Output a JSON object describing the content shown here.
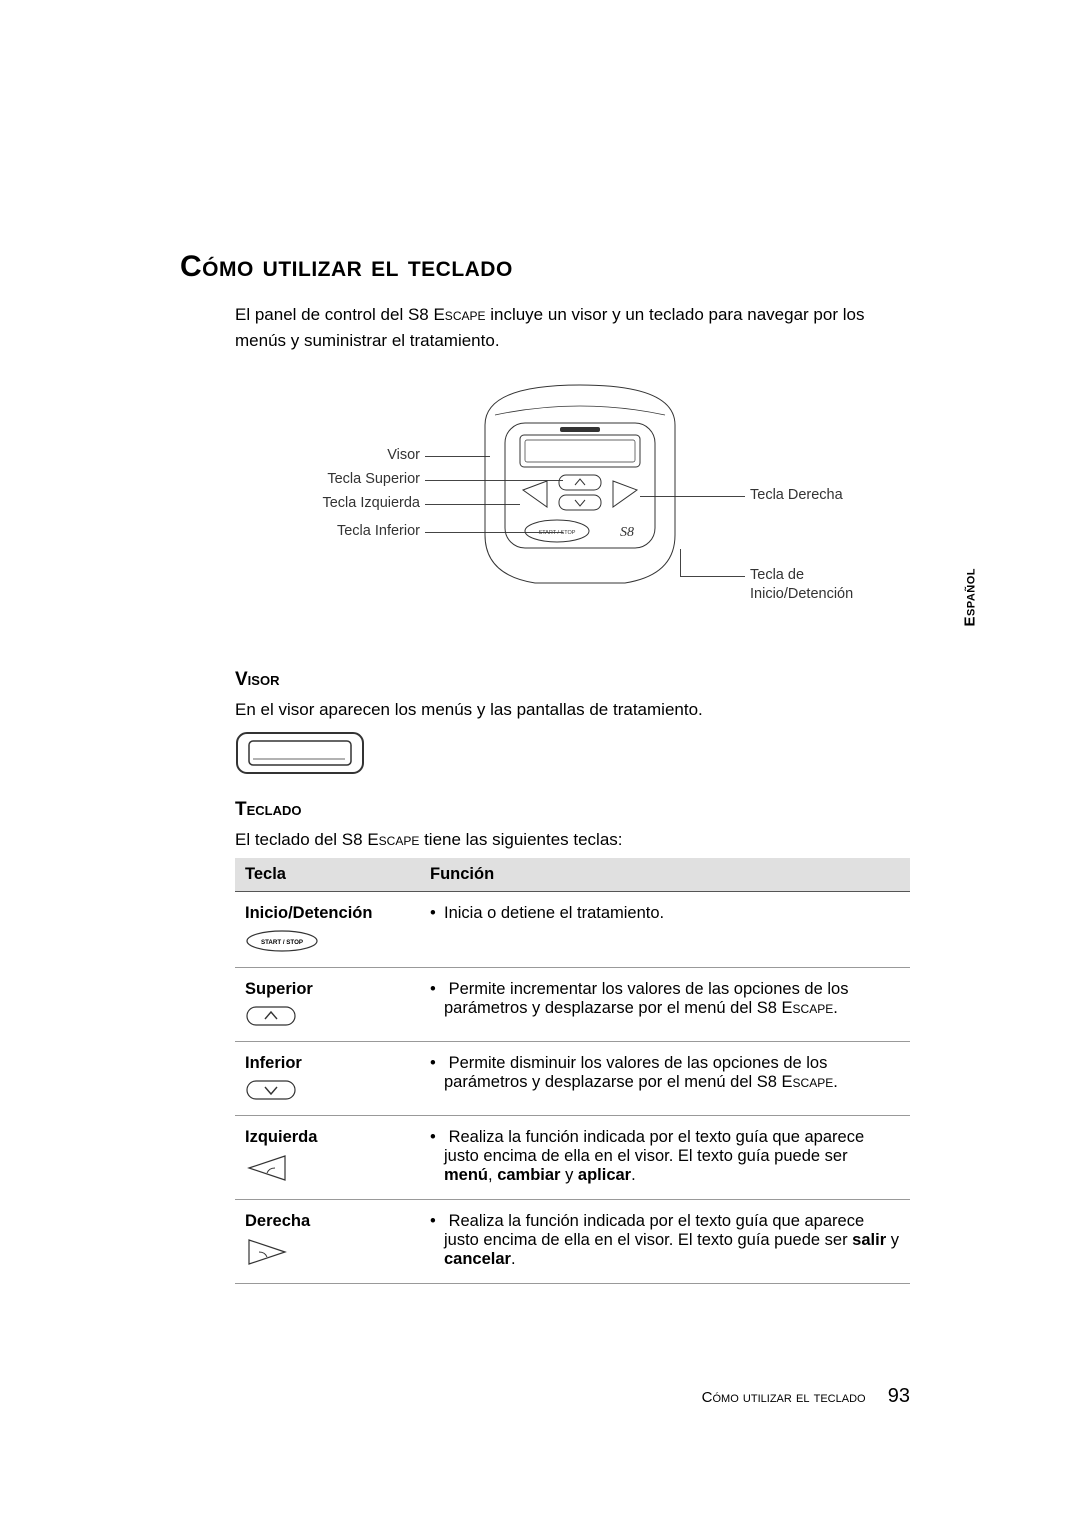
{
  "language_tab": "Español",
  "title": "Cómo utilizar el teclado",
  "intro_before": "El panel de control del ",
  "intro_device": "S8 Escape",
  "intro_after": " incluye un visor y un teclado para navegar por los menús y suministrar el tratamiento.",
  "diagram": {
    "labels": {
      "visor": "Visor",
      "tecla_superior": "Tecla Superior",
      "tecla_izquierda": "Tecla Izquierda",
      "tecla_inferior": "Tecla Inferior",
      "tecla_derecha": "Tecla Derecha",
      "tecla_inicio_l1": "Tecla de",
      "tecla_inicio_l2": "Inicio/Detención"
    },
    "start_stop_button": "START / STOP",
    "logo": "S8"
  },
  "sections": {
    "visor": {
      "heading": "Visor",
      "body": "En el visor aparecen los menús y las pantallas de tratamiento."
    },
    "teclado": {
      "heading": "Teclado",
      "body_before": "El teclado del ",
      "body_device": "S8 Escape",
      "body_after": " tiene las siguientes teclas:"
    }
  },
  "table": {
    "headers": {
      "tecla": "Tecla",
      "funcion": "Función"
    },
    "rows": [
      {
        "name": "Inicio/Detención",
        "icon": "start-stop",
        "desc": "Inicia o detiene el tratamiento."
      },
      {
        "name": "Superior",
        "icon": "up",
        "desc_before": "Permite incrementar los valores de las opciones de los parámetros y desplazarse por el menú del ",
        "desc_device": "S8 Escape",
        "desc_after": "."
      },
      {
        "name": "Inferior",
        "icon": "down",
        "desc_before": "Permite disminuir los valores de las opciones de los parámetros y desplazarse por el menú del ",
        "desc_device": "S8 Escape",
        "desc_after": "."
      },
      {
        "name": "Izquierda",
        "icon": "left",
        "desc_line1": "Realiza la función indicada por el texto guía que aparece justo encima de ella en el visor. El texto guía puede ser ",
        "desc_bold1": "menú",
        "desc_mid1": ", ",
        "desc_bold2": "cambiar",
        "desc_mid2": " y ",
        "desc_bold3": "aplicar",
        "desc_end": "."
      },
      {
        "name": "Derecha",
        "icon": "right",
        "desc_line1": "Realiza la función indicada por el texto guía que aparece justo encima de ella en el visor. El texto guía puede ser ",
        "desc_bold1": "salir",
        "desc_mid1": " y ",
        "desc_bold2": "cancelar",
        "desc_end": "."
      }
    ]
  },
  "footer": {
    "title": "Cómo utilizar el teclado",
    "page": "93"
  }
}
